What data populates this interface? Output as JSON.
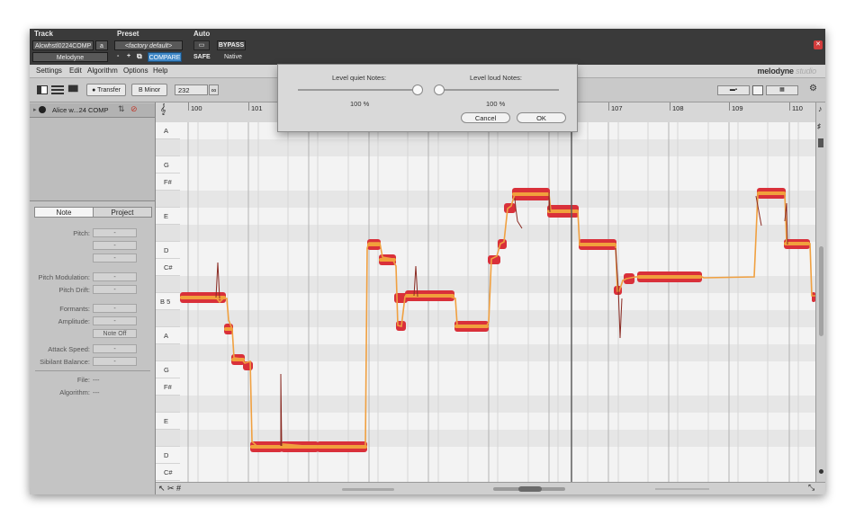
{
  "header": {
    "track_label": "Track",
    "preset_label": "Preset",
    "auto_label": "Auto",
    "track_name": "Alcwhstl0224COMP",
    "track_suffix": "a",
    "plugin": "Melodyne",
    "preset_value": "<factory default>",
    "minus": "-",
    "plus": "+",
    "compare": "COMPARE",
    "bypass": "BYPASS",
    "safe": "SAFE",
    "native": "Native"
  },
  "menu": {
    "items": [
      "Settings",
      "Edit",
      "Algorithm",
      "Options",
      "Help"
    ]
  },
  "logo": {
    "brand": "melodyne",
    "edition": "studio"
  },
  "toolbar": {
    "transfer": "Transfer",
    "key": "B Minor",
    "tempo": "232"
  },
  "left": {
    "track_name": "Alice w...24 COMP",
    "tabs": [
      "Note",
      "Project"
    ],
    "properties": [
      {
        "label": "Pitch:",
        "value": "-"
      },
      {
        "label": "",
        "value": "-"
      },
      {
        "label": "",
        "value": "-"
      },
      {
        "label": "Pitch Modulation:",
        "value": "-"
      },
      {
        "label": "Pitch Drift:",
        "value": "-"
      },
      {
        "label": "Formants:",
        "value": "-"
      },
      {
        "label": "Amplitude:",
        "value": "-"
      },
      {
        "label": "",
        "value": "Note Off"
      },
      {
        "label": "Attack Speed:",
        "value": "-"
      },
      {
        "label": "Sibilant Balance:",
        "value": "-"
      }
    ],
    "file_label": "File:",
    "file_value": "---",
    "algorithm_label": "Algorithm:",
    "algorithm_value": "---"
  },
  "ruler": {
    "bars": [
      "100",
      "101",
      "107",
      "108",
      "109",
      "110"
    ]
  },
  "keys": [
    "A",
    "G",
    "F#",
    "E",
    "D",
    "C#",
    "B 5",
    "A",
    "G",
    "F#",
    "E",
    "D",
    "C#"
  ],
  "dialog": {
    "quiet_label": "Level quiet Notes:",
    "loud_label": "Level loud Notes:",
    "quiet_pct": "100 %",
    "loud_pct": "100 %",
    "quiet_level": 1.0,
    "loud_level": 1.0,
    "cancel": "Cancel",
    "ok": "OK"
  },
  "colors": {
    "note_outer": "#d9303a",
    "note_inner": "#f2a03a",
    "pitch_curve": "#f0a040",
    "compare_blue": "#3d86c6"
  }
}
